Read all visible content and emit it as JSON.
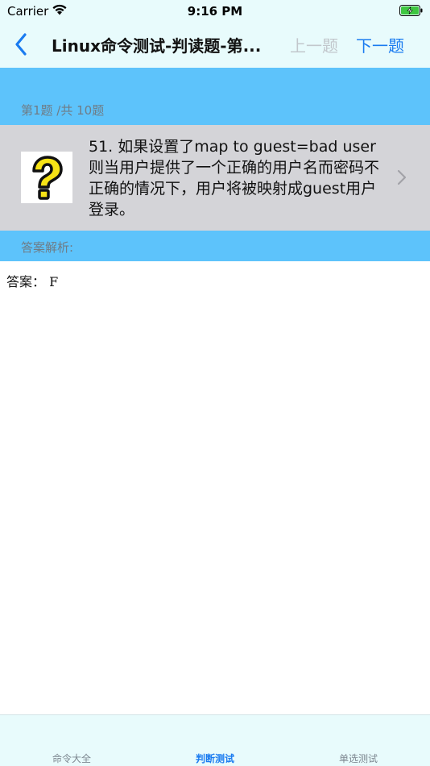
{
  "status_bar": {
    "carrier": "Carrier",
    "time": "9:16 PM"
  },
  "nav": {
    "title": "Linux命令测试-判读题-第...",
    "prev_label": "上一题",
    "next_label": "下一题",
    "back_icon": "chevron-left-icon"
  },
  "question": {
    "count_label": "第1题 /共 10题",
    "text": "51. 如果设置了map to guest=bad user则当用户提供了一个正确的用户名而密码不正确的情况下，用户将被映射成guest用户登录。",
    "image_icon": "question-mark-icon"
  },
  "answer": {
    "header_label": "答案解析:",
    "body": "答案：   F"
  },
  "tabs": [
    {
      "label": "命令大全",
      "active": false
    },
    {
      "label": "判断测试",
      "active": true
    },
    {
      "label": "单选测试",
      "active": false
    }
  ],
  "colors": {
    "accent": "#1a7bf0",
    "header_blue": "#5dc3fb",
    "bar_background": "#e8fbfc",
    "cell_gray": "#d4d4d8"
  }
}
